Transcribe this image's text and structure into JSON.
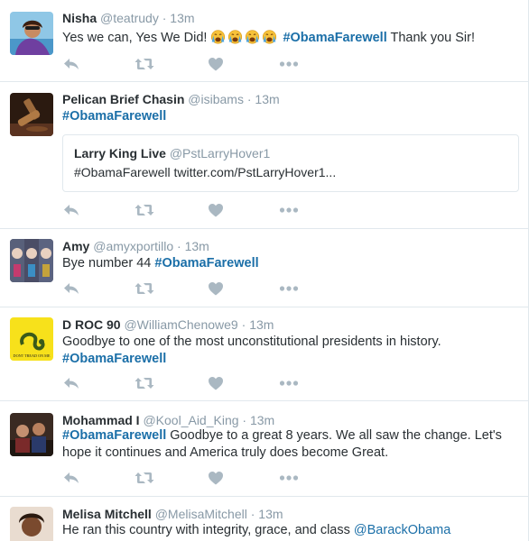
{
  "actions": {
    "reply_icon": "reply-icon",
    "retweet_icon": "retweet-icon",
    "like_icon": "heart-icon",
    "more_icon": "more-icon"
  },
  "colors": {
    "link": "#1b6fa8",
    "muted": "#8899a6",
    "action": "#aab8c2",
    "border": "#e1e8ed"
  },
  "tweets": [
    {
      "name": "Nisha",
      "handle": "@teatrudy",
      "separator": "·",
      "time": "13m",
      "text_before": "Yes we can, Yes We Did!",
      "emoji": "crying-face-emoji",
      "emoji_count": 4,
      "hashtag": "#ObamaFarewell",
      "text_after": "Thank you Sir!"
    },
    {
      "name": "Pelican Brief Chasin",
      "handle": "@isibams",
      "separator": "·",
      "time": "13m",
      "hashtag": "#ObamaFarewell",
      "quote": {
        "name": "Larry King Live",
        "handle": "@PstLarryHover1",
        "text": "#ObamaFarewell twitter.com/PstLarryHover1..."
      }
    },
    {
      "name": "Amy",
      "handle": "@amyxportillo",
      "separator": "·",
      "time": "13m",
      "text_before": "Bye number 44",
      "hashtag": "#ObamaFarewell"
    },
    {
      "name": "D ROC 90",
      "handle": "@WilliamChenowe9",
      "separator": "·",
      "time": "13m",
      "text_line1": "Goodbye to one of the most unconstitutional presidents in history.",
      "hashtag": "#ObamaFarewell",
      "avatar_caption": "DONT TREAD ON ME"
    },
    {
      "name": "Mohammad I",
      "handle": "@Kool_Aid_King",
      "separator": "·",
      "time": "13m",
      "hashtag": "#ObamaFarewell",
      "text_after_line1": "Goodbye to a great 8 years. We all saw the change. Let's",
      "text_line2": "hope it continues and America truly does become Great."
    },
    {
      "name": "Melisa Mitchell",
      "handle": "@MelisaMitchell",
      "separator": "·",
      "time": "13m",
      "text_before": "He ran this country with integrity, grace, and class",
      "mention": "@BarackObama"
    }
  ]
}
